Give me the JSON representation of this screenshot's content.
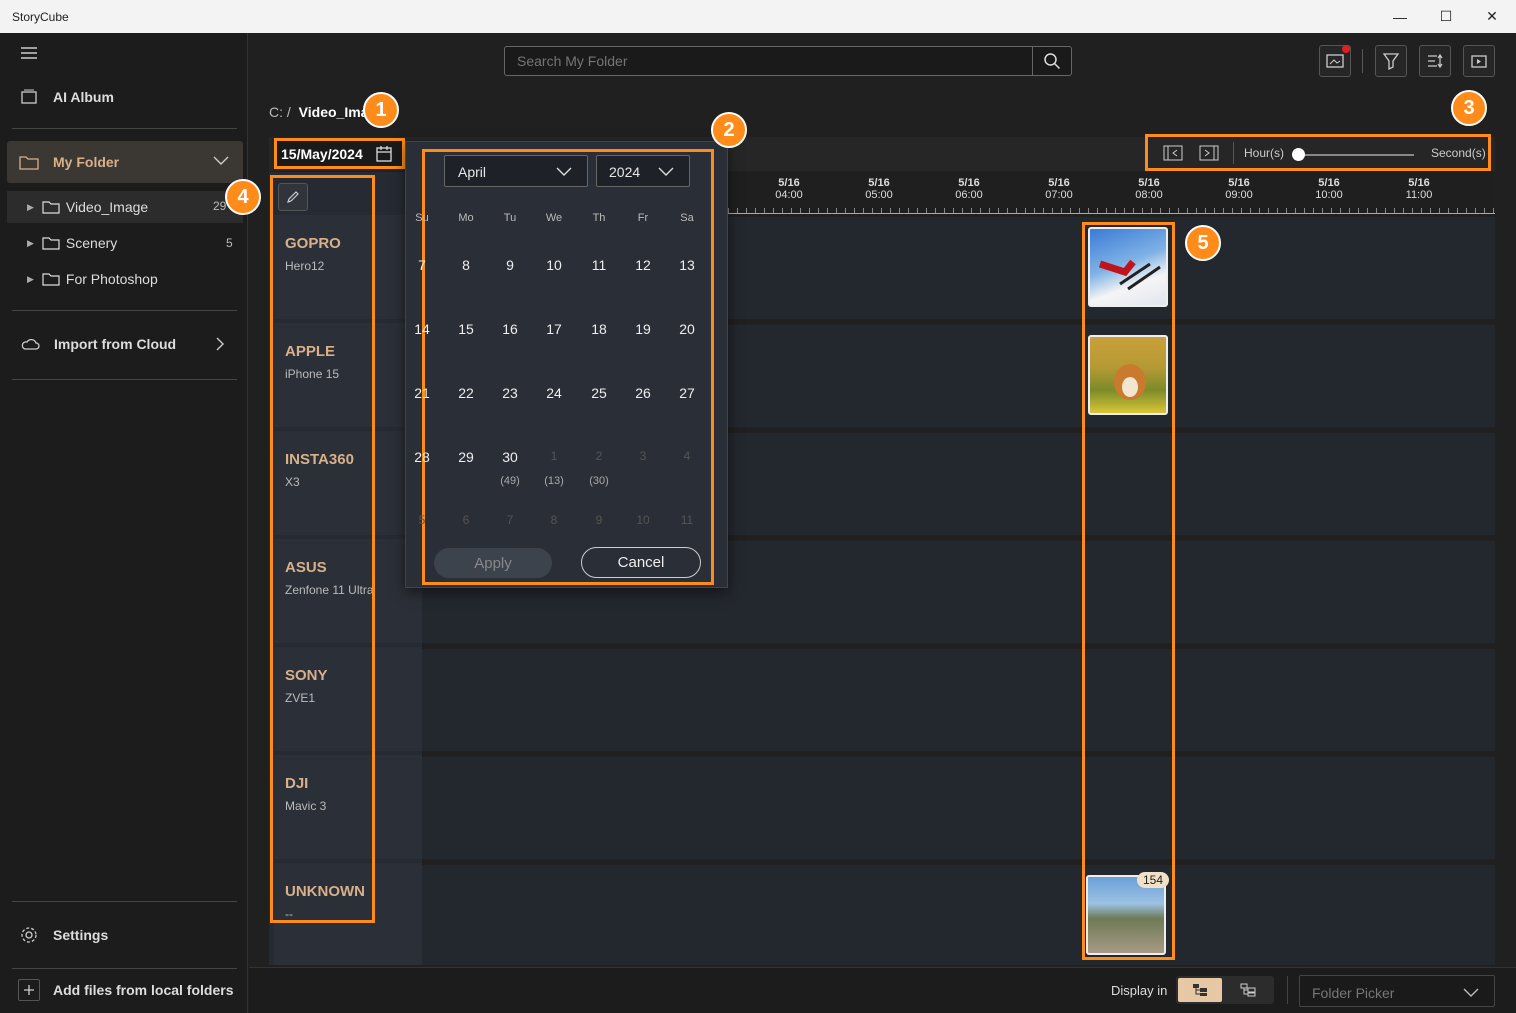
{
  "app": {
    "title": "StoryCube"
  },
  "window": {
    "minimize": "—",
    "maximize": "☐",
    "close": "✕"
  },
  "sidebar": {
    "ai_album": "AI Album",
    "my_folder": "My Folder",
    "folders": [
      {
        "name": "Video_Image",
        "count": "29"
      },
      {
        "name": "Scenery",
        "count": "5"
      },
      {
        "name": "For Photoshop",
        "count": ""
      }
    ],
    "import_cloud": "Import from Cloud",
    "settings": "Settings",
    "add_files": "Add files from local folders"
  },
  "toolbar": {
    "search_placeholder": "Search My Folder"
  },
  "breadcrumb": {
    "root": "C: /",
    "current": "Video_Imag"
  },
  "date_field": {
    "value": "15/May/2024"
  },
  "calendar": {
    "month": "April",
    "year": "2024",
    "weekdays": [
      "Su",
      "Mo",
      "Tu",
      "We",
      "Th",
      "Fr",
      "Sa"
    ],
    "weeks": [
      [
        "7",
        "8",
        "9",
        "10",
        "11",
        "12",
        "13"
      ],
      [
        "14",
        "15",
        "16",
        "17",
        "18",
        "19",
        "20"
      ],
      [
        "21",
        "22",
        "23",
        "24",
        "25",
        "26",
        "27"
      ],
      [
        "28",
        "29",
        "30",
        "1",
        "2",
        "3",
        "4"
      ],
      [
        "5",
        "6",
        "7",
        "8",
        "9",
        "10",
        "11"
      ]
    ],
    "counts": [
      "",
      "",
      "(49)",
      "(13)",
      "(30)",
      "",
      ""
    ],
    "apply": "Apply",
    "cancel": "Cancel"
  },
  "timeline": {
    "zoom_min": "Hour(s)",
    "zoom_max": "Second(s)",
    "zoom_level": 0,
    "ticks": [
      [
        "5/16",
        "04:00"
      ],
      [
        "5/16",
        "05:00"
      ],
      [
        "5/16",
        "06:00"
      ],
      [
        "5/16",
        "07:00"
      ],
      [
        "5/16",
        "08:00"
      ],
      [
        "5/16",
        "09:00"
      ],
      [
        "5/16",
        "10:00"
      ],
      [
        "5/16",
        "11:00"
      ]
    ]
  },
  "devices": [
    {
      "name": "GOPRO",
      "model": "Hero12"
    },
    {
      "name": "APPLE",
      "model": "iPhone 15"
    },
    {
      "name": "INSTA360",
      "model": "X3"
    },
    {
      "name": "ASUS",
      "model": "Zenfone 11 Ultra"
    },
    {
      "name": "SONY",
      "model": "ZVE1"
    },
    {
      "name": "DJI",
      "model": "Mavic 3"
    },
    {
      "name": "UNKNOWN",
      "model": "--"
    }
  ],
  "thumb_badge": "154",
  "callouts": [
    "1",
    "2",
    "3",
    "4",
    "5"
  ],
  "footer": {
    "display_in": "Display in",
    "folder_picker": "Folder Picker"
  },
  "colors": {
    "accent": "#ff8c1a",
    "device_name": "#d8b08a"
  }
}
